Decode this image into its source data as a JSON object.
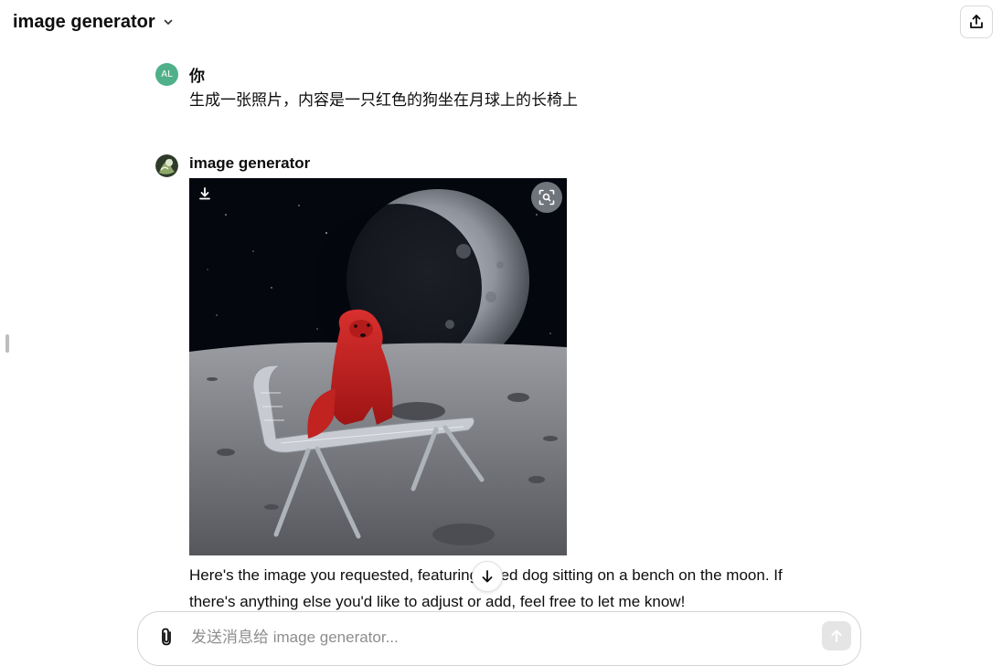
{
  "header": {
    "model_name": "image generator",
    "chevron_icon": "chevron-down-icon",
    "share_icon": "share-upload-icon"
  },
  "conversation": {
    "user_message": {
      "avatar_initials": "AL",
      "avatar_color": "#4fb08a",
      "sender": "你",
      "text": "生成一张照片，内容是一只红色的狗坐在月球上的长椅上"
    },
    "assistant_message": {
      "sender": "image generator",
      "avatar_icon": "gpt-avatar-image",
      "image_download_icon": "download-icon",
      "image_lens_icon": "scan-icon",
      "text": "Here's the image you requested, featuring a red dog sitting on a bench on the moon. If there's anything else you'd like to adjust or add, feel free to let me know!"
    }
  },
  "scroll_button_icon": "arrow-down-icon",
  "composer": {
    "placeholder": "发送消息给 image generator...",
    "attach_icon": "paperclip-icon",
    "send_icon": "arrow-up-icon"
  }
}
